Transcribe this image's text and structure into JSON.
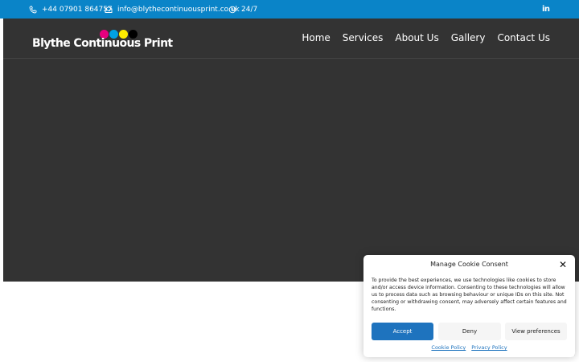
{
  "topbar": {
    "phone": "+44 07901 864757",
    "email": "info@blythecontinuousprint.co.uk",
    "hours": "24/7",
    "social": "in",
    "icons": [
      "phone-icon",
      "mail-icon",
      "clock-icon",
      "linkedin-icon"
    ]
  },
  "header": {
    "logo_text": "Blythe Continuous Print",
    "logo_dot_colors": [
      "#e6007e",
      "#00a0e3",
      "#ffed00",
      "#000000"
    ],
    "nav": [
      "Home",
      "Services",
      "About Us",
      "Gallery",
      "Contact Us"
    ]
  },
  "cookie": {
    "title": "Manage Cookie Consent",
    "message": "To provide the best experiences, we use technologies like cookies to store and/or access device information. Consenting to these technologies will allow us to process data such as browsing behaviour or unique IDs on this site. Not consenting or withdrawing consent, may adversely affect certain features and functions.",
    "accept": "Accept",
    "deny": "Deny",
    "preferences": "View preferences",
    "cookie_policy": "Cookie Policy",
    "privacy_policy": "Privacy Policy"
  },
  "colors": {
    "topbar": "#0a84c8",
    "hero": "#333333",
    "accent": "#1e73be"
  }
}
